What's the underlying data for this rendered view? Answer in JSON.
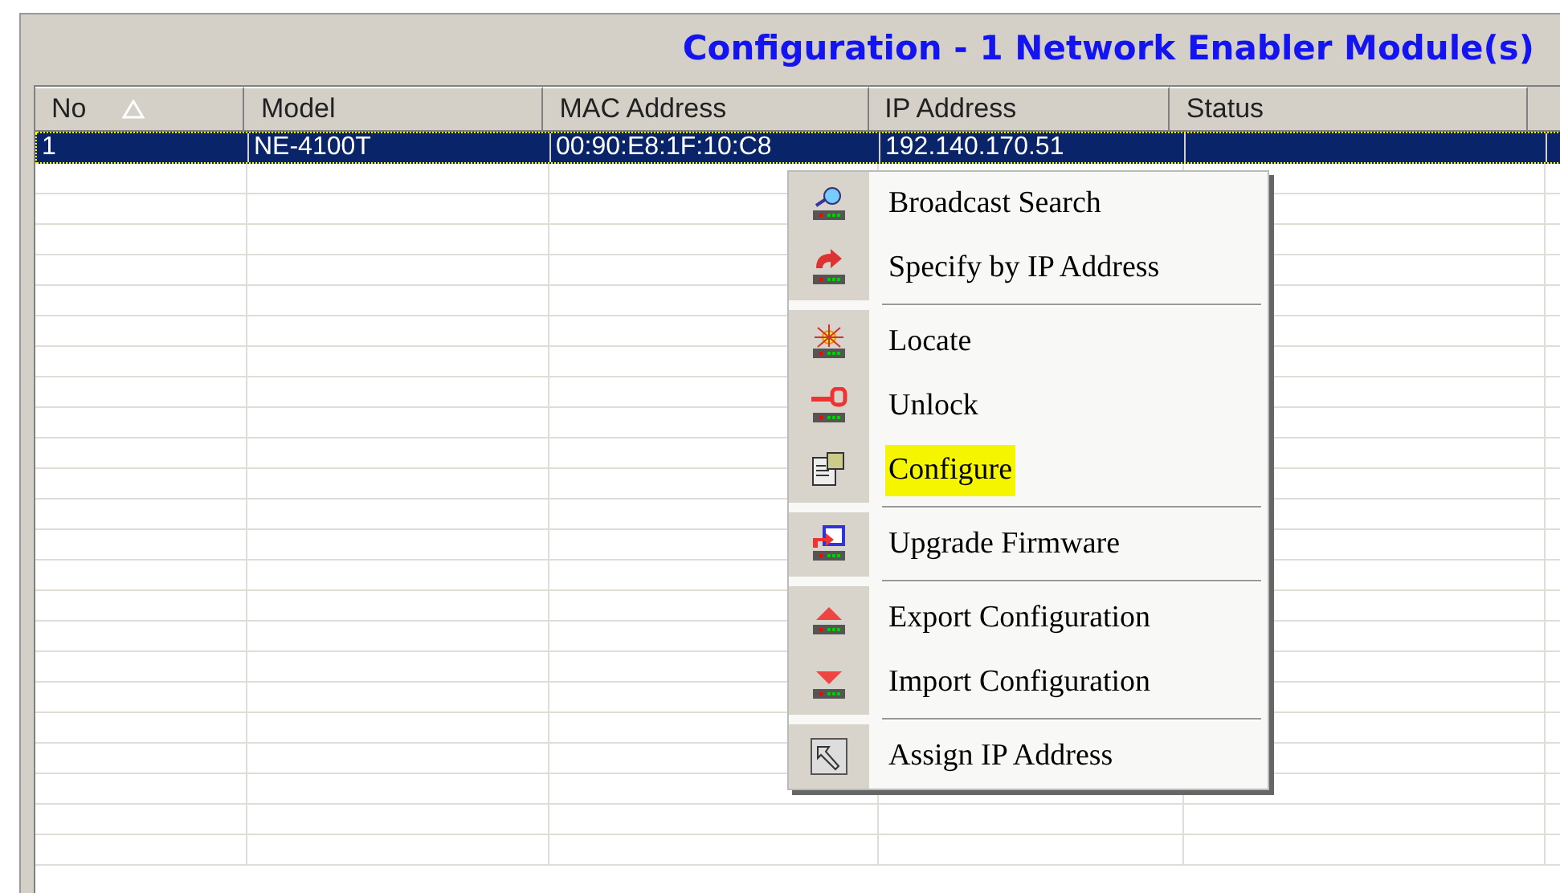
{
  "title": "Configuration - 1 Network Enabler Module(s)",
  "table": {
    "columns": [
      {
        "label": "No",
        "sorted": true
      },
      {
        "label": "Model",
        "sorted": false
      },
      {
        "label": "MAC Address",
        "sorted": false
      },
      {
        "label": "IP Address",
        "sorted": false
      },
      {
        "label": "Status",
        "sorted": false
      }
    ],
    "rows": [
      {
        "cells": [
          "1",
          "NE-4100T",
          "00:90:E8:1F:10:C8",
          "192.140.170.51",
          ""
        ],
        "selected": true
      }
    ]
  },
  "context_menu": {
    "items": [
      {
        "kind": "item",
        "label": "Broadcast Search",
        "highlighted": false
      },
      {
        "kind": "item",
        "label": "Specify by IP Address",
        "highlighted": false
      },
      {
        "kind": "separator"
      },
      {
        "kind": "item",
        "label": "Locate",
        "highlighted": false
      },
      {
        "kind": "item",
        "label": "Unlock",
        "highlighted": false
      },
      {
        "kind": "item",
        "label": "Configure",
        "highlighted": true
      },
      {
        "kind": "separator"
      },
      {
        "kind": "item",
        "label": "Upgrade Firmware",
        "highlighted": false
      },
      {
        "kind": "separator"
      },
      {
        "kind": "item",
        "label": "Export Configuration",
        "highlighted": false
      },
      {
        "kind": "item",
        "label": "Import Configuration",
        "highlighted": false
      },
      {
        "kind": "separator"
      },
      {
        "kind": "item",
        "label": "Assign IP Address",
        "highlighted": false
      }
    ]
  }
}
